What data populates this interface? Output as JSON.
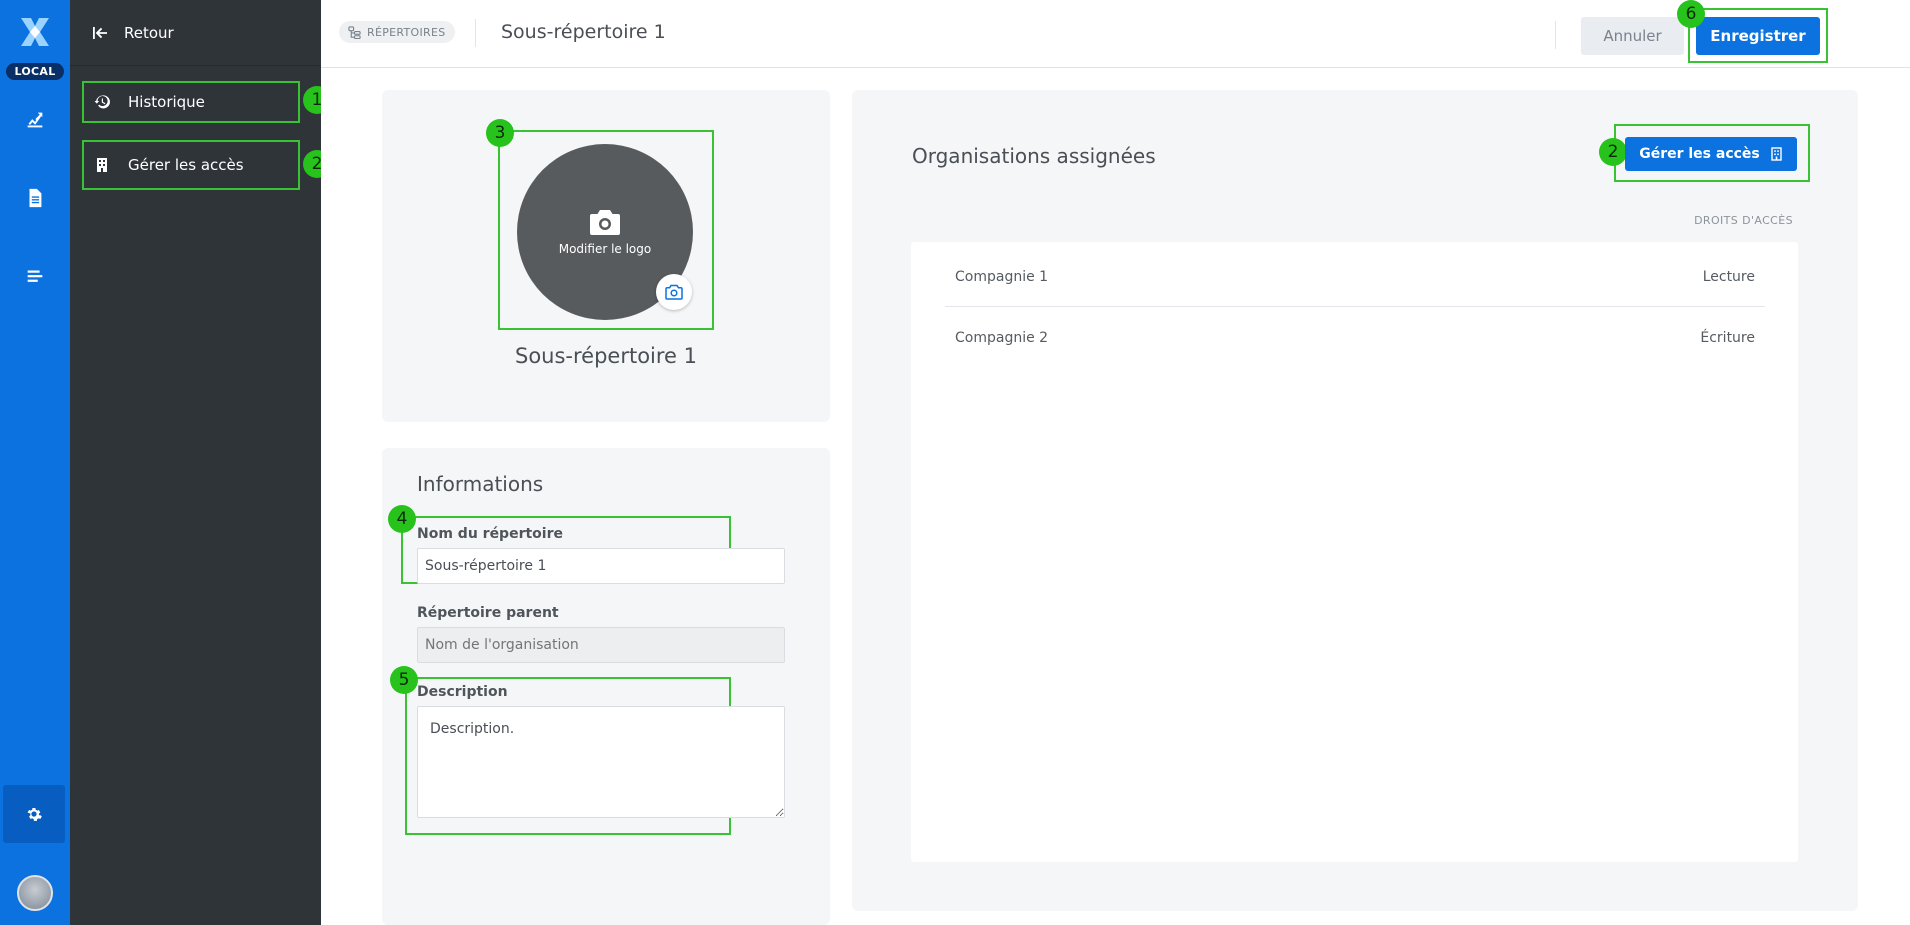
{
  "rail": {
    "env_badge": "LOCAL",
    "items": [
      {
        "icon": "edit-chart-icon"
      },
      {
        "icon": "document-icon"
      },
      {
        "icon": "list-icon"
      }
    ],
    "settings_icon": "gear-icon",
    "accent": "#0b72e0"
  },
  "sidebar": {
    "back_label": "Retour",
    "items": [
      {
        "label": "Historique",
        "icon": "history-icon",
        "marker": "1"
      },
      {
        "label": "Gérer les accès",
        "icon": "building-icon",
        "marker": "2"
      }
    ]
  },
  "header": {
    "breadcrumb": "RÉPERTOIRES",
    "title": "Sous-répertoire 1",
    "cancel_label": "Annuler",
    "save_label": "Enregistrer",
    "save_marker": "6"
  },
  "logo_card": {
    "marker": "3",
    "change_logo_label": "Modifier le logo",
    "name": "Sous-répertoire 1"
  },
  "info": {
    "title": "Informations",
    "name_marker": "4",
    "name_label": "Nom du répertoire",
    "name_value": "Sous-répertoire 1",
    "parent_label": "Répertoire parent",
    "parent_placeholder": "Nom de l'organisation",
    "description_marker": "5",
    "description_label": "Description",
    "description_value": "Description."
  },
  "organizations": {
    "title": "Organisations assignées",
    "manage_label": "Gérer les accès",
    "manage_marker": "2",
    "column_header": "DROITS D'ACCÈS",
    "rows": [
      {
        "name": "Compagnie 1",
        "right": "Lecture"
      },
      {
        "name": "Compagnie 2",
        "right": "Écriture"
      }
    ]
  },
  "colors": {
    "primary": "#0b72e0",
    "sidebar_bg": "#2f3439",
    "highlight": "#39c234"
  }
}
